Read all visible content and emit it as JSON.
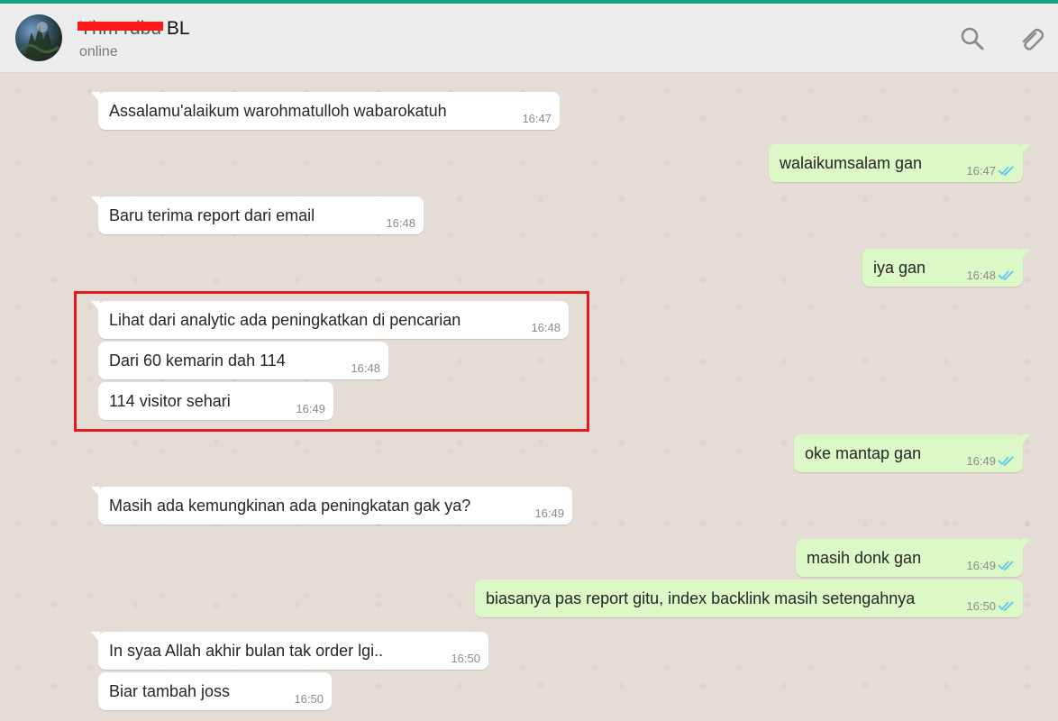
{
  "contact": {
    "name_redacted": "Yhm rdbu",
    "name_visible": "BL",
    "status": "online"
  },
  "messages": [
    {
      "dir": "in",
      "text": "Assalamu'alaikum warohmatulloh wabarokatuh",
      "time": "16:47"
    },
    {
      "dir": "out",
      "text": "walaikumsalam gan",
      "time": "16:47"
    },
    {
      "dir": "in",
      "text": "Baru terima report dari email",
      "time": "16:48"
    },
    {
      "dir": "out",
      "text": "iya gan",
      "time": "16:48"
    },
    {
      "dir": "in",
      "text": "Lihat dari analytic ada peningkatkan di pencarian",
      "time": "16:48"
    },
    {
      "dir": "in",
      "text": "Dari 60 kemarin dah 114",
      "time": "16:48"
    },
    {
      "dir": "in",
      "text": "114 visitor sehari",
      "time": "16:49"
    },
    {
      "dir": "out",
      "text": "oke mantap gan",
      "time": "16:49"
    },
    {
      "dir": "in",
      "text": "Masih ada kemungkinan ada peningkatan gak ya?",
      "time": "16:49"
    },
    {
      "dir": "out",
      "text": "masih donk gan",
      "time": "16:49"
    },
    {
      "dir": "out",
      "text": "biasanya pas report gitu, index backlink masih setengahnya",
      "time": "16:50"
    },
    {
      "dir": "in",
      "text": "In syaa Allah akhir bulan tak order lgi..",
      "time": "16:50"
    },
    {
      "dir": "in",
      "text": "Biar tambah joss",
      "time": "16:50"
    }
  ],
  "icons": {
    "search": "search-icon",
    "attach": "paperclip-icon",
    "read_receipt": "double-check-icon"
  },
  "colors": {
    "accent": "#1a9e88",
    "bubble_out": "#dcf8c6",
    "bubble_in": "#ffffff",
    "tick_read": "#4fc3f7",
    "highlight_box": "#e31b1b"
  }
}
